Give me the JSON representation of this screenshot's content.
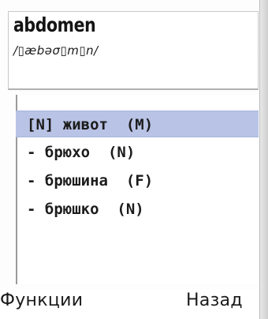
{
  "entry": {
    "headword": "abdomen",
    "transcription": "/▯æbəσ▯m▯n/"
  },
  "translations": [
    {
      "text": "[N] живот  (M)",
      "selected": true
    },
    {
      "text": "- брюхо  (N)",
      "selected": false
    },
    {
      "text": "- брюшина  (F)",
      "selected": false
    },
    {
      "text": "- брюшко  (N)",
      "selected": false
    }
  ],
  "softkeys": {
    "left_label": "Функции",
    "right_label": "Назад"
  },
  "colors": {
    "selection": "#b9c3e6",
    "text": "#1c1c1c",
    "background": "#ffffff"
  }
}
